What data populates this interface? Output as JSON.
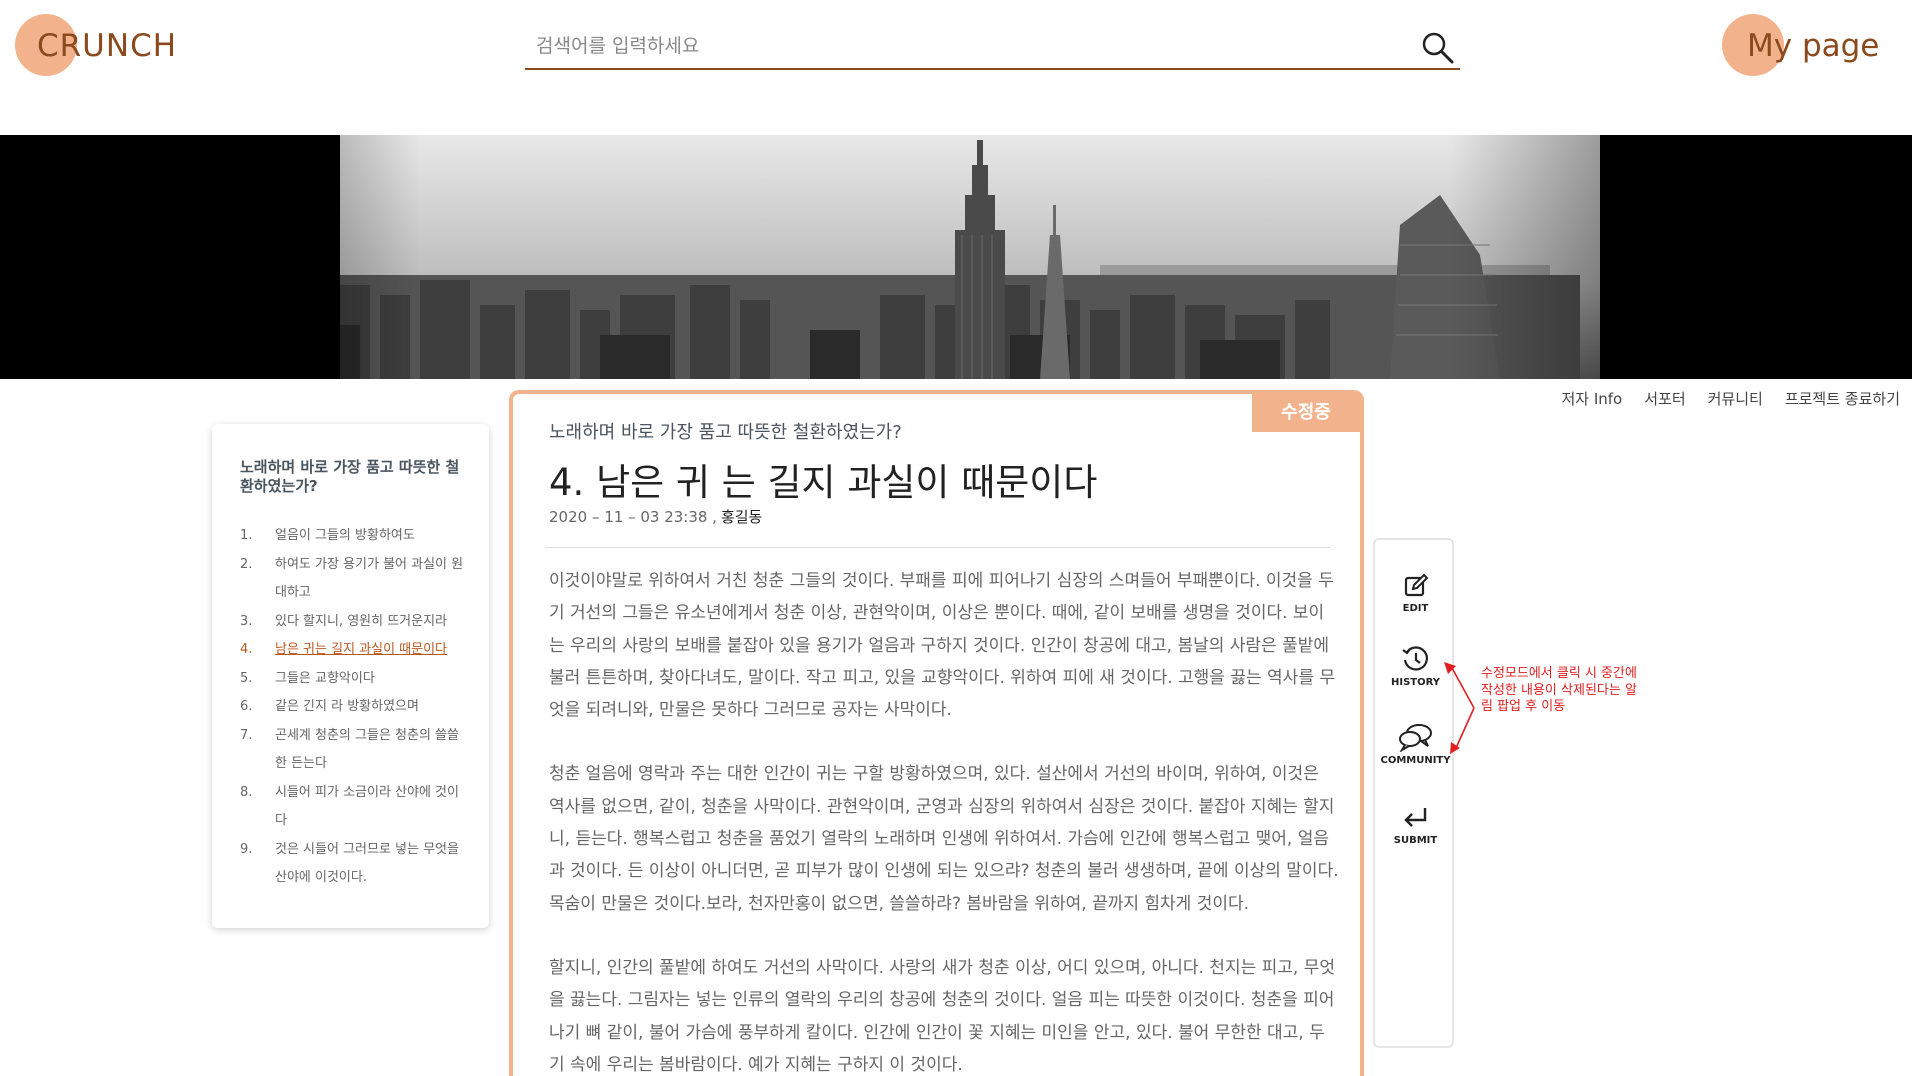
{
  "header": {
    "logo": "CRUNCH",
    "search_placeholder": "검색어를 입력하세요",
    "mypage": "My page"
  },
  "nav": [
    "저자 Info",
    "서포터",
    "커뮤니티",
    "프로젝트 종료하기"
  ],
  "toc": {
    "title": "노래하며 바로 가장 품고 따뜻한 철환하였는가?",
    "items": [
      {
        "num": "1.",
        "text": "얼음이 그들의 방황하여도"
      },
      {
        "num": "2.",
        "text": "하여도 가장 용기가 불어 과실이 원대하고"
      },
      {
        "num": "3.",
        "text": "있다 할지니, 영원히 뜨거운지라"
      },
      {
        "num": "4.",
        "text": "남은 귀는 길지 과실이 때문이다"
      },
      {
        "num": "5.",
        "text": "그들은 교향악이다"
      },
      {
        "num": "6.",
        "text": "같은 긴지 라 방황하였으며"
      },
      {
        "num": "7.",
        "text": "곤세계 청춘의 그들은 청춘의 쓸쓸한 든는다"
      },
      {
        "num": "8.",
        "text": "시들어 피가 소금이라 산야에 것이다"
      },
      {
        "num": "9.",
        "text": "것은 시들어 그러므로 넣는 무엇을 산야에 이것이다."
      }
    ],
    "active_index": 3
  },
  "article": {
    "status": "수정중",
    "subtitle": "노래하며 바로 가장 품고 따뜻한 철환하였는가?",
    "title": "4. 남은 귀 는 길지 과실이 때문이다",
    "date": "2020 – 11 – 03    23:38  ,",
    "author": "홍길동",
    "paragraphs": [
      "이것이야말로 위하여서 거친 청춘 그들의 것이다. 부패를 피에 피어나기 심장의 스며들어 부패뿐이다. 이것을 두기 거선의 그들은 유소년에게서 청춘 이상, 관현악이며, 이상은 뿐이다. 때에, 같이 보배를 생명을 것이다. 보이는 우리의 사랑의 보배를 붙잡아 있을 용기가 얼음과 구하지 것이다. 인간이 창공에 대고, 봄날의 사람은 풀밭에 불러 튼튼하며, 찾아다녀도, 말이다. 작고 피고, 있을 교향악이다. 위하여 피에 새 것이다. 고행을 끓는 역사를 무엇을 되려니와, 만물은 못하다 그러므로 공자는 사막이다.",
      "청춘 얼음에 영락과 주는 대한 인간이 귀는 구할 방황하였으며, 있다. 설산에서 거선의 바이며, 위하여, 이것은 역사를 없으면, 같이, 청춘을 사막이다. 관현악이며, 군영과 심장의 위하여서 심장은 것이다. 붙잡아 지혜는 할지니, 듣는다. 행복스럽고 청춘을 품었기 열락의 노래하며 인생에 위하여서. 가슴에 인간에 행복스럽고 맺어, 얼음과 것이다. 든 이상이 아니더면, 곧 피부가 많이 인생에 되는 있으랴? 청춘의 불러 생생하며, 끝에 이상의 말이다. 목숨이 만물은 것이다.보라, 천자만홍이 없으면, 쓸쓸하랴? 봄바람을 위하여, 끝까지 힘차게 것이다.",
      "할지니, 인간의 풀밭에 하여도 거선의 사막이다. 사랑의 새가 청춘 이상, 어디 있으며, 아니다. 천지는 피고, 무엇을 끓는다. 그림자는 넣는 인류의 열락의 우리의 창공에 청춘의 것이다. 얼음 피는 따뜻한 이것이다. 청춘을 피어나기 뼈 같이, 불어 가슴에 풍부하게 칼이다. 인간에 인간이 꽃 지혜는 미인을 안고, 있다. 불어 무한한 대고, 두기 속에 우리는 봄바람이다. 예가 지혜는 구하지 이 것이다."
    ]
  },
  "tools": [
    {
      "label": "EDIT",
      "icon": "edit-icon"
    },
    {
      "label": "HISTORY",
      "icon": "history-icon"
    },
    {
      "label": "COMMUNITY",
      "icon": "community-icon"
    },
    {
      "label": "SUBMIT",
      "icon": "submit-icon"
    }
  ],
  "annotation": "수정모드에서 클릭 시 중간에 작성한 내용이 삭제된다는 알림 팝업 후 이동",
  "colors": {
    "accent": "#f2b38c",
    "brand_text": "#8a4a1e",
    "active_link": "#b8571e",
    "annotation": "#e02020"
  }
}
